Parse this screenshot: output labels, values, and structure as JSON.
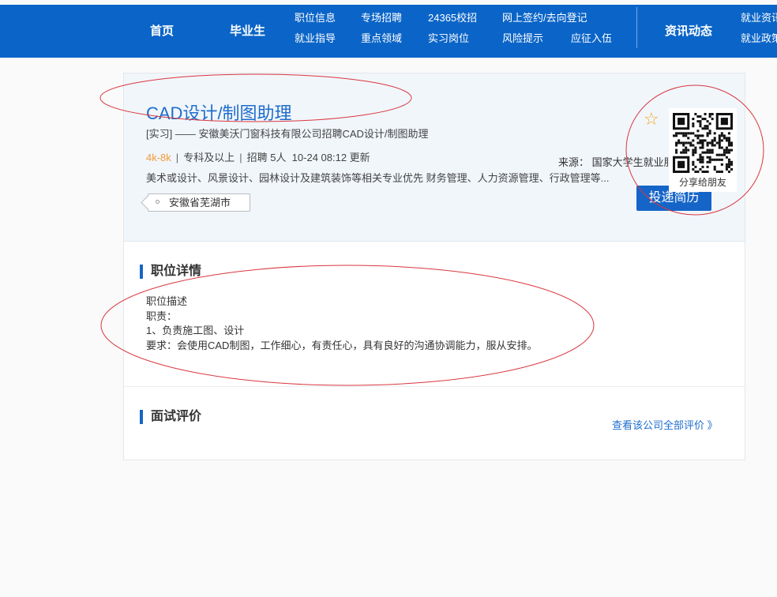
{
  "nav": {
    "home": "首页",
    "graduates": "毕业生",
    "sub_row1": [
      "职位信息",
      "专场招聘",
      "24365校招",
      "网上签约/去向登记"
    ],
    "sub_row2": [
      "就业指导",
      "重点领域",
      "实习岗位",
      "风险提示",
      "应征入伍"
    ],
    "news": "资讯动态",
    "right_row1": "就业资讯",
    "right_row2": "就业政策"
  },
  "job": {
    "title": "CAD设计/制图助理",
    "subtitle": "[实习]  ——  安徽美沃门窗科技有限公司招聘CAD设计/制图助理",
    "salary": "4k-8k",
    "education": "专科及以上",
    "recruit": "招聘 5人",
    "updated": "10-24 08:12 更新",
    "requirements": "美术或设计、风景设计、园林设计及建筑装饰等相关专业优先 财务管理、人力资源管理、行政管理等...",
    "location": "安徽省芜湖市",
    "source": "来源： 国家大学生就业服务平台",
    "apply_label": "投递简历",
    "share_label": "分享给朋友"
  },
  "detail": {
    "section_title": "职位详情",
    "lines": [
      "职位描述",
      "职责：",
      "1、负责施工图、设计",
      "要求：会使用CAD制图，工作细心，有责任心，具有良好的沟通协调能力，服从安排。"
    ]
  },
  "review": {
    "section_title": "面试评价",
    "more_link": "查看该公司全部评价 》"
  },
  "colors": {
    "nav_bg": "#0b65c8",
    "title_blue": "#1e6dcc",
    "salary_orange": "#f29a3a",
    "annotation_red": "#d9363e"
  }
}
